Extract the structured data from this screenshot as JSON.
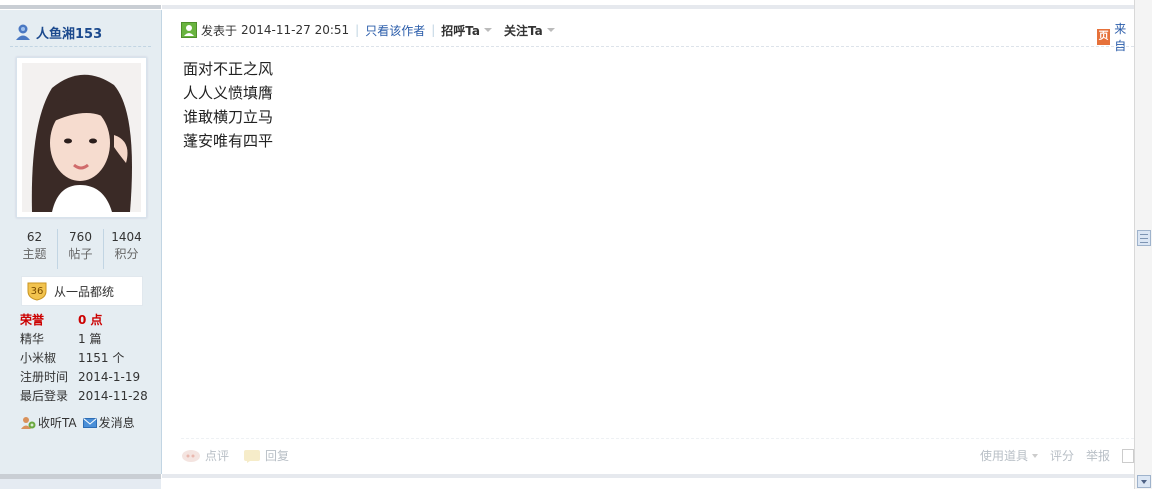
{
  "author": {
    "name": "人鱼湘153",
    "stats": [
      {
        "value": "62",
        "label": "主题"
      },
      {
        "value": "760",
        "label": "帖子"
      },
      {
        "value": "1404",
        "label": "积分"
      }
    ],
    "rank": {
      "level": "36",
      "title": "从一品都统"
    },
    "info": {
      "honor": {
        "label": "荣誉",
        "value": "0 点"
      },
      "digest": {
        "label": "精华",
        "value": "1 篇"
      },
      "currency": {
        "label": "小米椒",
        "value": "1151 个"
      },
      "register": {
        "label": "注册时间",
        "value": "2014-1-19"
      },
      "last_login": {
        "label": "最后登录",
        "value": "2014-11-28"
      }
    },
    "actions": {
      "follow": "收听TA",
      "message": "发消息"
    }
  },
  "post": {
    "posted_label": "发表于",
    "timestamp": "2014-11-27 20:51",
    "only_author": "只看该作者",
    "greet": "招呼Ta",
    "follow": "关注Ta",
    "source": "来自",
    "lines": [
      "面对不正之风",
      "人人义愤填膺",
      "谁敢横刀立马",
      "蓬安唯有四平"
    ],
    "footer": {
      "comment": "点评",
      "reply": "回复",
      "tools": "使用道具",
      "rate": "评分",
      "report": "举报"
    }
  },
  "colors": {
    "link": "#2a5caa",
    "honor": "#cc0000",
    "sidebar_bg": "#e5edf2"
  }
}
